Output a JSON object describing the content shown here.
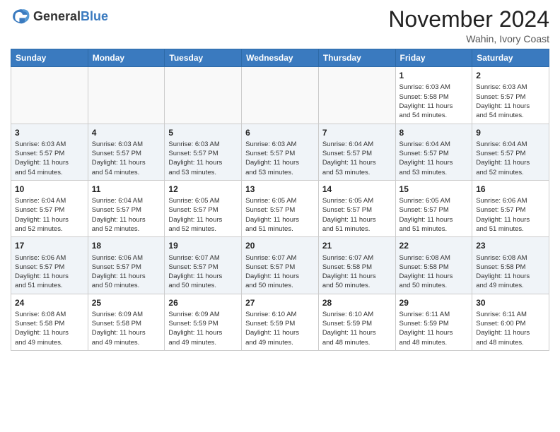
{
  "header": {
    "logo_general": "General",
    "logo_blue": "Blue",
    "month_title": "November 2024",
    "location": "Wahin, Ivory Coast"
  },
  "weekdays": [
    "Sunday",
    "Monday",
    "Tuesday",
    "Wednesday",
    "Thursday",
    "Friday",
    "Saturday"
  ],
  "weeks": [
    [
      {
        "day": "",
        "info": ""
      },
      {
        "day": "",
        "info": ""
      },
      {
        "day": "",
        "info": ""
      },
      {
        "day": "",
        "info": ""
      },
      {
        "day": "",
        "info": ""
      },
      {
        "day": "1",
        "info": "Sunrise: 6:03 AM\nSunset: 5:58 PM\nDaylight: 11 hours\nand 54 minutes."
      },
      {
        "day": "2",
        "info": "Sunrise: 6:03 AM\nSunset: 5:57 PM\nDaylight: 11 hours\nand 54 minutes."
      }
    ],
    [
      {
        "day": "3",
        "info": "Sunrise: 6:03 AM\nSunset: 5:57 PM\nDaylight: 11 hours\nand 54 minutes."
      },
      {
        "day": "4",
        "info": "Sunrise: 6:03 AM\nSunset: 5:57 PM\nDaylight: 11 hours\nand 54 minutes."
      },
      {
        "day": "5",
        "info": "Sunrise: 6:03 AM\nSunset: 5:57 PM\nDaylight: 11 hours\nand 53 minutes."
      },
      {
        "day": "6",
        "info": "Sunrise: 6:03 AM\nSunset: 5:57 PM\nDaylight: 11 hours\nand 53 minutes."
      },
      {
        "day": "7",
        "info": "Sunrise: 6:04 AM\nSunset: 5:57 PM\nDaylight: 11 hours\nand 53 minutes."
      },
      {
        "day": "8",
        "info": "Sunrise: 6:04 AM\nSunset: 5:57 PM\nDaylight: 11 hours\nand 53 minutes."
      },
      {
        "day": "9",
        "info": "Sunrise: 6:04 AM\nSunset: 5:57 PM\nDaylight: 11 hours\nand 52 minutes."
      }
    ],
    [
      {
        "day": "10",
        "info": "Sunrise: 6:04 AM\nSunset: 5:57 PM\nDaylight: 11 hours\nand 52 minutes."
      },
      {
        "day": "11",
        "info": "Sunrise: 6:04 AM\nSunset: 5:57 PM\nDaylight: 11 hours\nand 52 minutes."
      },
      {
        "day": "12",
        "info": "Sunrise: 6:05 AM\nSunset: 5:57 PM\nDaylight: 11 hours\nand 52 minutes."
      },
      {
        "day": "13",
        "info": "Sunrise: 6:05 AM\nSunset: 5:57 PM\nDaylight: 11 hours\nand 51 minutes."
      },
      {
        "day": "14",
        "info": "Sunrise: 6:05 AM\nSunset: 5:57 PM\nDaylight: 11 hours\nand 51 minutes."
      },
      {
        "day": "15",
        "info": "Sunrise: 6:05 AM\nSunset: 5:57 PM\nDaylight: 11 hours\nand 51 minutes."
      },
      {
        "day": "16",
        "info": "Sunrise: 6:06 AM\nSunset: 5:57 PM\nDaylight: 11 hours\nand 51 minutes."
      }
    ],
    [
      {
        "day": "17",
        "info": "Sunrise: 6:06 AM\nSunset: 5:57 PM\nDaylight: 11 hours\nand 51 minutes."
      },
      {
        "day": "18",
        "info": "Sunrise: 6:06 AM\nSunset: 5:57 PM\nDaylight: 11 hours\nand 50 minutes."
      },
      {
        "day": "19",
        "info": "Sunrise: 6:07 AM\nSunset: 5:57 PM\nDaylight: 11 hours\nand 50 minutes."
      },
      {
        "day": "20",
        "info": "Sunrise: 6:07 AM\nSunset: 5:57 PM\nDaylight: 11 hours\nand 50 minutes."
      },
      {
        "day": "21",
        "info": "Sunrise: 6:07 AM\nSunset: 5:58 PM\nDaylight: 11 hours\nand 50 minutes."
      },
      {
        "day": "22",
        "info": "Sunrise: 6:08 AM\nSunset: 5:58 PM\nDaylight: 11 hours\nand 50 minutes."
      },
      {
        "day": "23",
        "info": "Sunrise: 6:08 AM\nSunset: 5:58 PM\nDaylight: 11 hours\nand 49 minutes."
      }
    ],
    [
      {
        "day": "24",
        "info": "Sunrise: 6:08 AM\nSunset: 5:58 PM\nDaylight: 11 hours\nand 49 minutes."
      },
      {
        "day": "25",
        "info": "Sunrise: 6:09 AM\nSunset: 5:58 PM\nDaylight: 11 hours\nand 49 minutes."
      },
      {
        "day": "26",
        "info": "Sunrise: 6:09 AM\nSunset: 5:59 PM\nDaylight: 11 hours\nand 49 minutes."
      },
      {
        "day": "27",
        "info": "Sunrise: 6:10 AM\nSunset: 5:59 PM\nDaylight: 11 hours\nand 49 minutes."
      },
      {
        "day": "28",
        "info": "Sunrise: 6:10 AM\nSunset: 5:59 PM\nDaylight: 11 hours\nand 48 minutes."
      },
      {
        "day": "29",
        "info": "Sunrise: 6:11 AM\nSunset: 5:59 PM\nDaylight: 11 hours\nand 48 minutes."
      },
      {
        "day": "30",
        "info": "Sunrise: 6:11 AM\nSunset: 6:00 PM\nDaylight: 11 hours\nand 48 minutes."
      }
    ]
  ]
}
